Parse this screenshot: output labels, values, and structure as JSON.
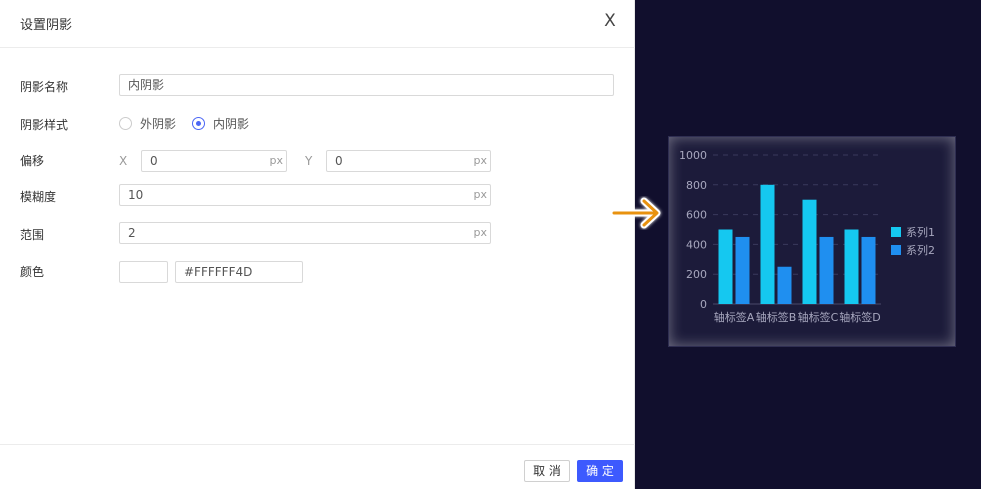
{
  "dialog": {
    "title": "设置阴影",
    "close_glyph": "X"
  },
  "form": {
    "name": {
      "label": "阴影名称",
      "value": "内阴影"
    },
    "style": {
      "label": "阴影样式",
      "options": [
        "外阴影",
        "内阴影"
      ],
      "selected": "内阴影"
    },
    "offset": {
      "label": "偏移",
      "x": {
        "tag": "X",
        "value": "0",
        "unit": "px"
      },
      "y": {
        "tag": "Y",
        "value": "0",
        "unit": "px"
      }
    },
    "blur": {
      "label": "模糊度",
      "value": "10",
      "unit": "px"
    },
    "spread": {
      "label": "范围",
      "value": "2",
      "unit": "px"
    },
    "color": {
      "label": "颜色",
      "swatch": "#FFFFFF",
      "value": "#FFFFFF4D"
    }
  },
  "footer": {
    "cancel_label": "取 消",
    "ok_label": "确 定"
  },
  "preview": {
    "arrow_icon": "arrow-right-icon",
    "arrow_color": "#e8920f",
    "background": "#110f2d"
  },
  "chart_data": {
    "type": "bar",
    "categories": [
      "轴标签A",
      "轴标签B",
      "轴标签C",
      "轴标签D"
    ],
    "series": [
      {
        "name": "系列1",
        "values": [
          500,
          800,
          700,
          500
        ],
        "color": "#15c8f0"
      },
      {
        "name": "系列2",
        "values": [
          450,
          250,
          450,
          450
        ],
        "color": "#1f8ff0"
      }
    ],
    "ylim": [
      0,
      1000
    ],
    "yticks": [
      0,
      200,
      400,
      600,
      800,
      1000
    ],
    "grid": true,
    "legend": "right"
  }
}
